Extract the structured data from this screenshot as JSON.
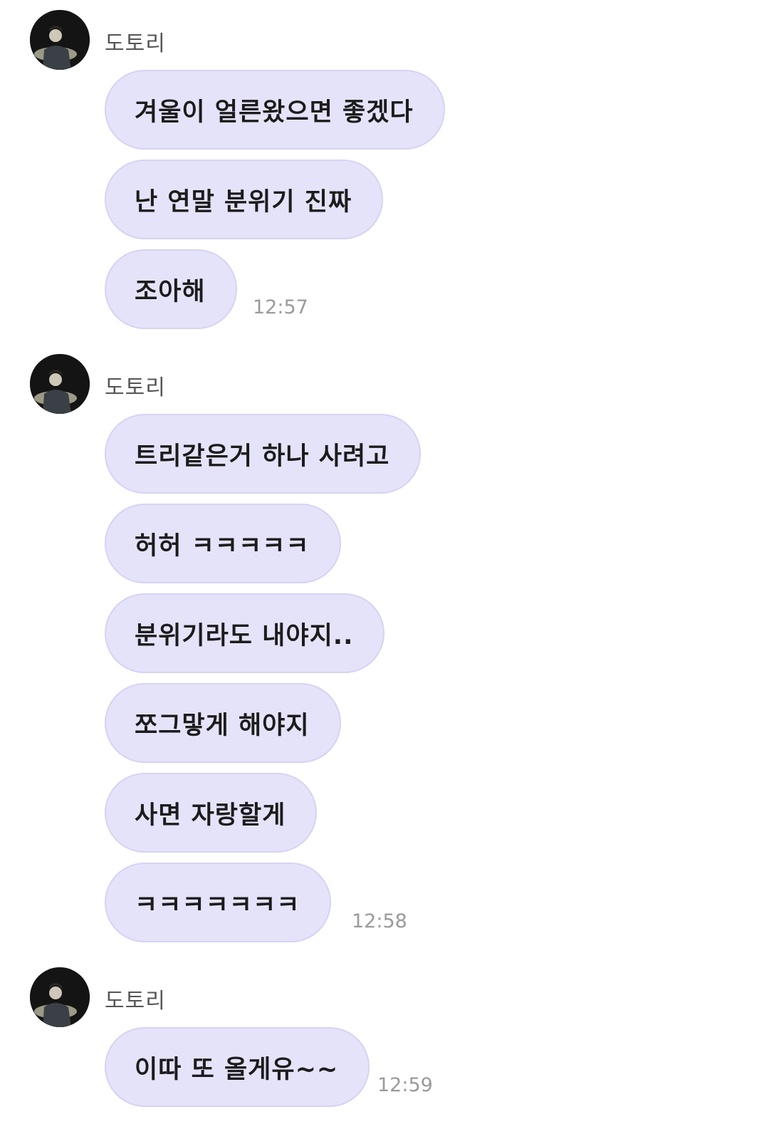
{
  "app_colors": {
    "bubble_background": "#e5e3fa",
    "bubble_border": "#d6d3f4",
    "timestamp": "#9a9a9a",
    "sender_name": "#555555"
  },
  "messages": [
    {
      "sender": "도토리",
      "avatar_icon": "profile-photo",
      "bubbles": [
        "겨울이 얼른왔으면 좋겠다",
        "난 연말 분위기 진짜",
        "조아해"
      ],
      "time": "12:57"
    },
    {
      "sender": "도토리",
      "avatar_icon": "profile-photo",
      "bubbles": [
        "트리같은거 하나 사려고",
        "허허 ㅋㅋㅋㅋㅋ",
        "분위기라도 내야지..",
        "쪼그맣게 해야지",
        "사면 자랑할게",
        "ㅋㅋㅋㅋㅋㅋㅋ"
      ],
      "time": "12:58"
    },
    {
      "sender": "도토리",
      "avatar_icon": "profile-photo",
      "bubbles": [
        "이따 또 올게유~~"
      ],
      "time": "12:59"
    }
  ]
}
